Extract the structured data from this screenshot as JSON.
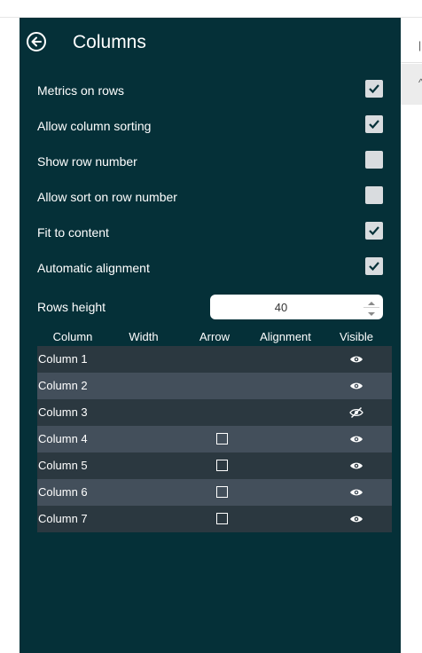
{
  "panel": {
    "title": "Columns"
  },
  "options": [
    {
      "label": "Metrics on rows",
      "checked": true
    },
    {
      "label": "Allow column sorting",
      "checked": true
    },
    {
      "label": "Show row number",
      "checked": false
    },
    {
      "label": "Allow sort on row number",
      "checked": false
    },
    {
      "label": "Fit to content",
      "checked": true
    },
    {
      "label": "Automatic alignment",
      "checked": true
    }
  ],
  "rows_height": {
    "label": "Rows height",
    "value": "40"
  },
  "table": {
    "headers": [
      "Column",
      "Width",
      "Arrow",
      "Alignment",
      "Visible"
    ],
    "rows": [
      {
        "name": "Column 1",
        "arrow_checkbox": false,
        "visible": true
      },
      {
        "name": "Column 2",
        "arrow_checkbox": false,
        "visible": true
      },
      {
        "name": "Column 3",
        "arrow_checkbox": false,
        "visible": false
      },
      {
        "name": "Column 4",
        "arrow_checkbox": true,
        "visible": true
      },
      {
        "name": "Column 5",
        "arrow_checkbox": true,
        "visible": true
      },
      {
        "name": "Column 6",
        "arrow_checkbox": true,
        "visible": true
      },
      {
        "name": "Column 7",
        "arrow_checkbox": true,
        "visible": true
      }
    ]
  },
  "colors": {
    "panel_bg": "#053038",
    "row_dark": "#2b3840",
    "row_light": "#434f5b",
    "checkbox_bg": "#d9dcdf"
  }
}
